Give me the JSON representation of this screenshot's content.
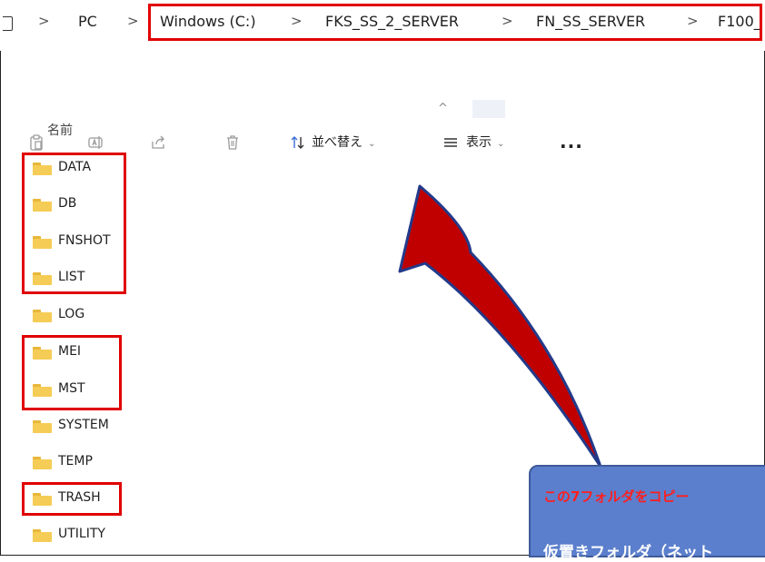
{
  "breadcrumb": {
    "items": [
      "PC",
      "Windows (C:)",
      "FKS_SS_2_SERVER",
      "FN_SS_SERVER",
      "F100_"
    ],
    "separator": ">"
  },
  "toolbar": {
    "icons": [
      "paste-icon",
      "rename-icon",
      "share-icon",
      "delete-icon"
    ],
    "sort_label": "並べ替え",
    "view_label": "表示",
    "more_label": "..."
  },
  "list": {
    "column_name": "名前",
    "folders": [
      "DATA",
      "DB",
      "FNSHOT",
      "LIST",
      "LOG",
      "MEI",
      "MST",
      "SYSTEM",
      "TEMP",
      "TRASH",
      "UTILITY"
    ]
  },
  "callout": {
    "line1": "この7フォルダをコピー",
    "line2": "仮置きフォルダ（ネット"
  },
  "colors": {
    "highlight": "#e00000",
    "arrow_fill": "#c00000",
    "callout_bg": "#5b7fcd",
    "callout_text_red": "#ff1f1f",
    "folder_yellow": "#f5cc55"
  }
}
